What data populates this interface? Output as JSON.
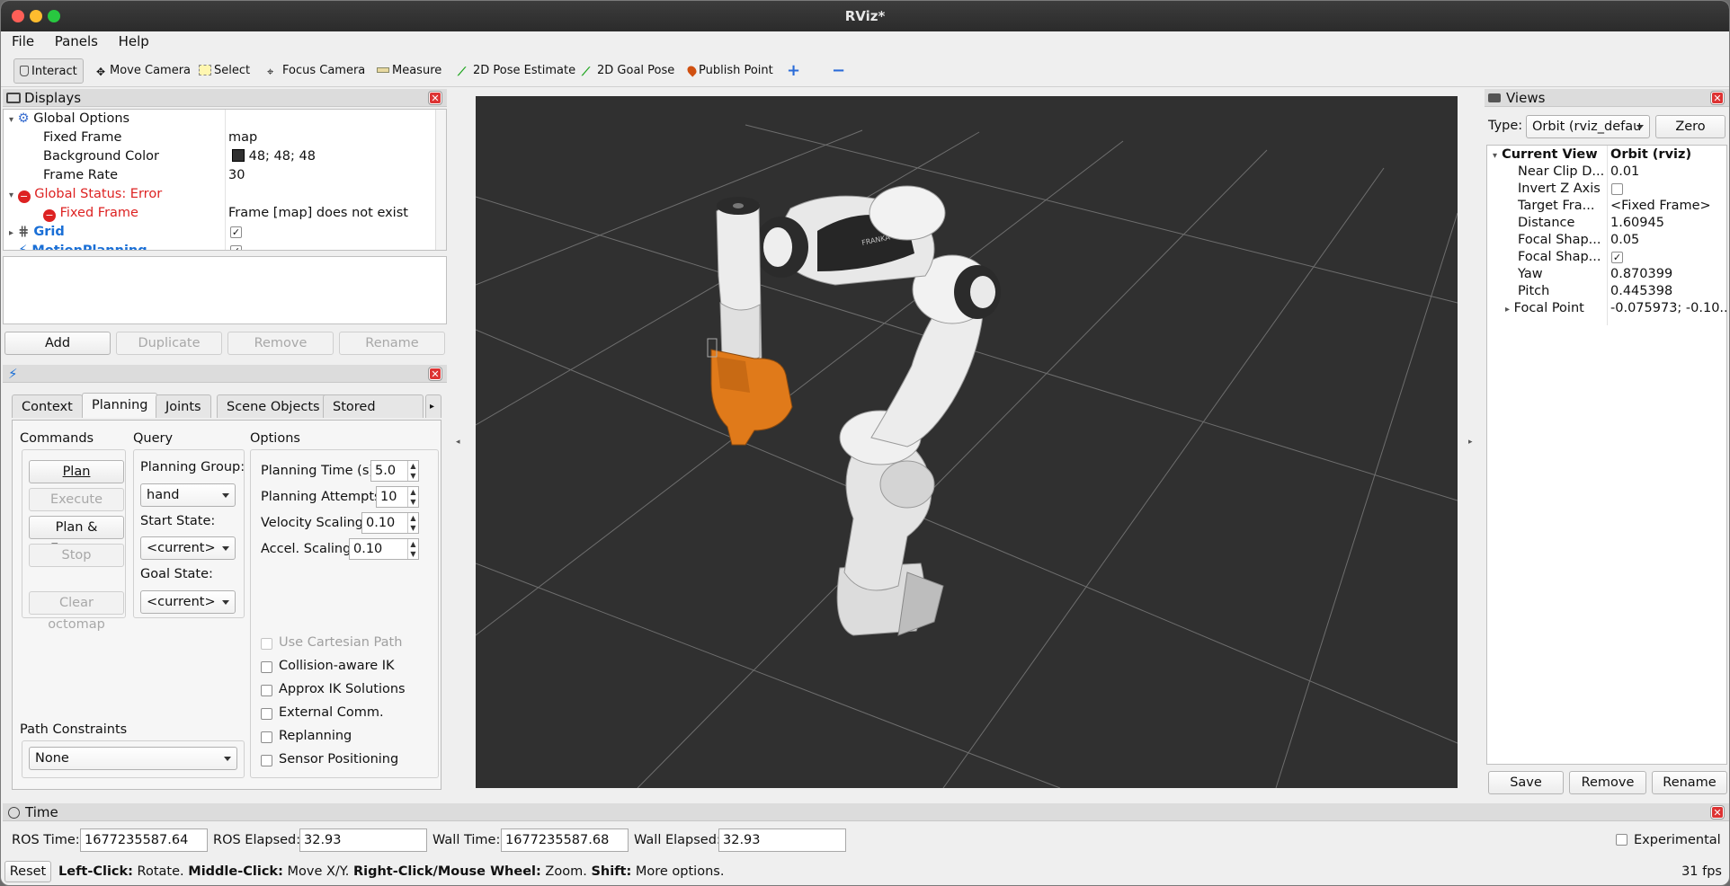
{
  "window": {
    "title": "RViz*"
  },
  "menu": [
    "File",
    "Panels",
    "Help"
  ],
  "toolbar": {
    "interact": "Interact",
    "move_camera": "Move Camera",
    "select": "Select",
    "focus_camera": "Focus Camera",
    "measure": "Measure",
    "pose_estimate": "2D Pose Estimate",
    "goal_pose": "2D Goal Pose",
    "publish_point": "Publish Point"
  },
  "displays": {
    "title": "Displays",
    "global_options": "Global Options",
    "fixed_frame_label": "Fixed Frame",
    "fixed_frame_value": "map",
    "bg_color_label": "Background Color",
    "bg_color_value": "48; 48; 48",
    "frame_rate_label": "Frame Rate",
    "frame_rate_value": "30",
    "global_status": "Global Status: Error",
    "status_fixed_frame": "Fixed Frame",
    "status_message": "Frame [map] does not exist",
    "grid": "Grid",
    "motion_planning": "MotionPlanning",
    "buttons": {
      "add": "Add",
      "duplicate": "Duplicate",
      "remove": "Remove",
      "rename": "Rename"
    }
  },
  "motion": {
    "tabs": [
      "Context",
      "Planning",
      "Joints",
      "Scene Objects",
      "Stored Scene"
    ],
    "commands_title": "Commands",
    "query_title": "Query",
    "options_title": "Options",
    "plan": "Plan",
    "execute": "Execute",
    "plan_execute": "Plan & Execute",
    "stop": "Stop",
    "clear_octomap": "Clear octomap",
    "planning_group_label": "Planning Group:",
    "planning_group": "hand",
    "start_state_label": "Start State:",
    "start_state": "<current>",
    "goal_state_label": "Goal State:",
    "goal_state": "<current>",
    "planning_time_label": "Planning Time (s):",
    "planning_time": "5.0",
    "planning_attempts_label": "Planning Attempts:",
    "planning_attempts": "10",
    "velocity_label": "Velocity Scaling:",
    "velocity": "0.10",
    "accel_label": "Accel. Scaling:",
    "accel": "0.10",
    "cartesian": "Use Cartesian Path",
    "collision_ik": "Collision-aware IK",
    "approx_ik": "Approx IK Solutions",
    "external_comm": "External Comm.",
    "replanning": "Replanning",
    "sensor_positioning": "Sensor Positioning",
    "path_constraints_label": "Path Constraints",
    "path_constraints": "None"
  },
  "views": {
    "title": "Views",
    "type_label": "Type:",
    "type_value": "Orbit (rviz_defau",
    "zero": "Zero",
    "current_view": "Current View",
    "current_view_value": "Orbit (rviz)",
    "props": [
      {
        "name": "Near Clip D...",
        "value": "0.01"
      },
      {
        "name": "Invert Z Axis",
        "value": ""
      },
      {
        "name": "Target Fra...",
        "value": "<Fixed Frame>"
      },
      {
        "name": "Distance",
        "value": "1.60945"
      },
      {
        "name": "Focal Shap...",
        "value": "0.05"
      },
      {
        "name": "Focal Shap...",
        "value": ""
      },
      {
        "name": "Yaw",
        "value": "0.870399"
      },
      {
        "name": "Pitch",
        "value": "0.445398"
      },
      {
        "name": "Focal Point",
        "value": "-0.075973; -0.10..."
      }
    ],
    "buttons": {
      "save": "Save",
      "remove": "Remove",
      "rename": "Rename"
    }
  },
  "time": {
    "title": "Time",
    "ros_time_label": "ROS Time:",
    "ros_time": "1677235587.64",
    "ros_elapsed_label": "ROS Elapsed:",
    "ros_elapsed": "32.93",
    "wall_time_label": "Wall Time:",
    "wall_time": "1677235587.68",
    "wall_elapsed_label": "Wall Elapsed:",
    "wall_elapsed": "32.93",
    "experimental": "Experimental"
  },
  "status": {
    "reset": "Reset",
    "left_click": "Left-Click:",
    "left_action": " Rotate. ",
    "middle_click": "Middle-Click:",
    "middle_action": " Move X/Y. ",
    "right_click": "Right-Click/Mouse Wheel:",
    "right_action": " Zoom. ",
    "shift": "Shift:",
    "shift_action": " More options.",
    "fps": "31 fps"
  },
  "robot": {
    "brand_text": "FRANKA"
  },
  "colors": {
    "viewport_bg": "#303030",
    "error": "#d22",
    "link_blue": "#1a6fd6",
    "gripper": "#e07a1a"
  }
}
